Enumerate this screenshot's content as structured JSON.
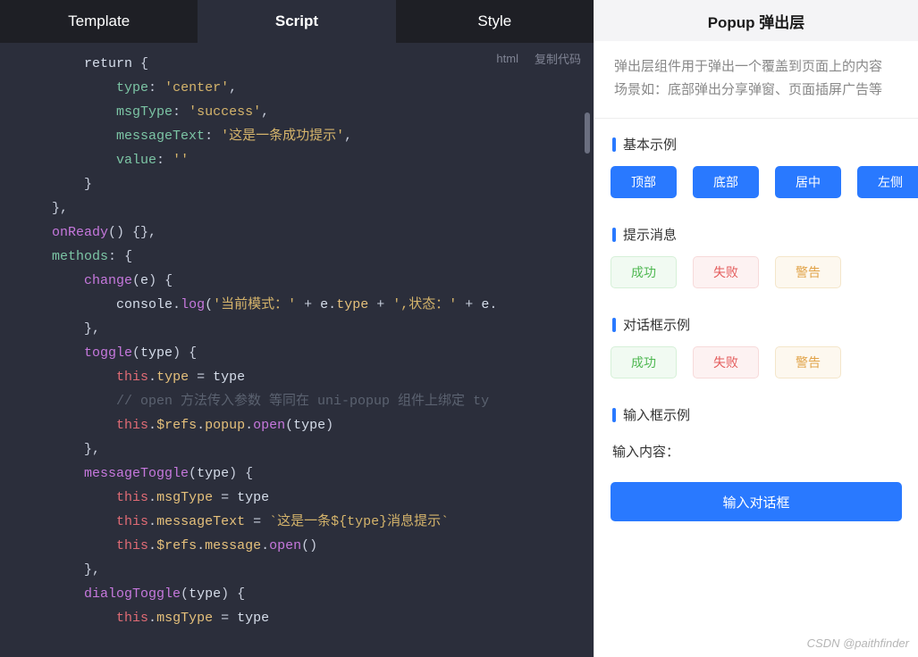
{
  "tabs": {
    "template": "Template",
    "script": "Script",
    "style": "Style",
    "active": "Script"
  },
  "code_meta": {
    "lang": "html",
    "copy": "复制代码"
  },
  "code": {
    "l1": "return",
    "type_k": "type",
    "type_v": "'center'",
    "msgType_k": "msgType",
    "msgType_v": "'success'",
    "messageText_k": "messageText",
    "messageText_v": "'这是一条成功提示'",
    "value_k": "value",
    "value_v": "''",
    "onReady": "onReady",
    "methods": "methods",
    "change": "change",
    "change_arg": "e",
    "console": "console",
    "log": "log",
    "log_str1": "'当前模式：'",
    "log_plus": "+",
    "log_e": "e",
    "log_type": "type",
    "log_str2": "',状态：'",
    "toggle": "toggle",
    "toggle_arg": "type",
    "this": "this",
    "eq": "=",
    "cmt_open": "// open 方法传入参数 等同在 uni-popup 组件上绑定 ty",
    "refs": "$refs",
    "popup": "popup",
    "open": "open",
    "messageToggle": "messageToggle",
    "msgType_prop": "msgType",
    "messageText_prop": "messageText",
    "tpl_str": "`这是一条${type}消息提示`",
    "message": "message",
    "dialogToggle": "dialogToggle"
  },
  "preview": {
    "title": "Popup 弹出层",
    "desc_l1": "弹出层组件用于弹出一个覆盖到页面上的内容",
    "desc_l2": "场景如：底部弹出分享弹窗、页面插屏广告等",
    "sections": {
      "basic": {
        "title": "基本示例",
        "buttons": [
          "顶部",
          "底部",
          "居中",
          "左侧"
        ]
      },
      "message": {
        "title": "提示消息",
        "buttons": [
          "成功",
          "失败",
          "警告"
        ]
      },
      "dialog": {
        "title": "对话框示例",
        "buttons": [
          "成功",
          "失败",
          "警告"
        ]
      },
      "input": {
        "title": "输入框示例",
        "label": "输入内容：",
        "button": "输入对话框"
      }
    },
    "watermark": "CSDN @paithfinder"
  }
}
